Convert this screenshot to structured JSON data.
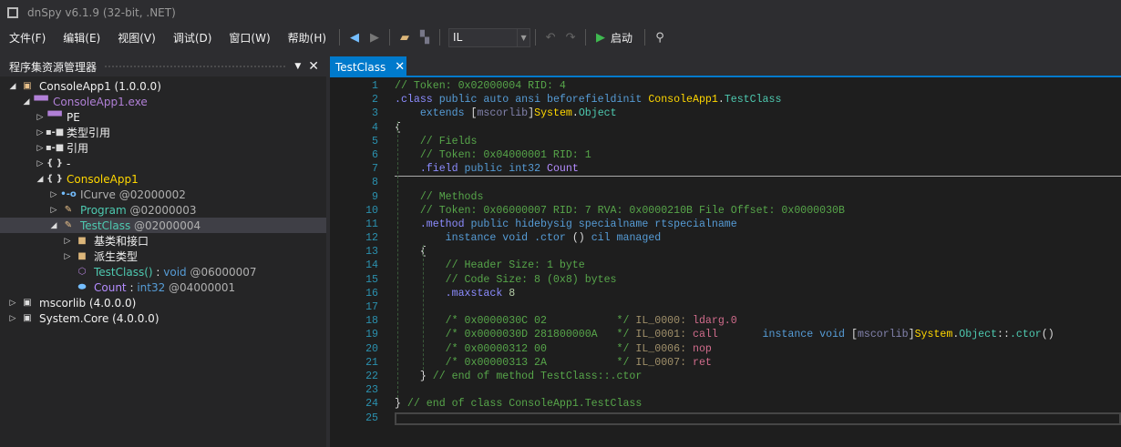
{
  "window": {
    "title": "dnSpy v6.1.9 (32-bit, .NET)"
  },
  "menu": [
    "文件(F)",
    "编辑(E)",
    "视图(V)",
    "调试(D)",
    "窗口(W)",
    "帮助(H)"
  ],
  "toolbar": {
    "language": "IL",
    "start_label": "启动"
  },
  "explorer": {
    "title": "程序集资源管理器",
    "rows": [
      {
        "indent": 0,
        "tw": "◢",
        "icon": "assembly-icon",
        "glyph": "▣",
        "gc": "#e8c08a",
        "parts": [
          [
            "ConsoleApp1 (1.0.0.0)",
            "#f1f1f1"
          ]
        ]
      },
      {
        "indent": 1,
        "tw": "◢",
        "icon": "module-icon",
        "glyph": "▀▀",
        "gc": "#b180d7",
        "parts": [
          [
            "ConsoleApp1.exe",
            "#b180d7"
          ]
        ]
      },
      {
        "indent": 2,
        "tw": "▷",
        "icon": "pe-icon",
        "glyph": "▀▀",
        "gc": "#b180d7",
        "parts": [
          [
            "PE",
            "#f1f1f1"
          ]
        ]
      },
      {
        "indent": 2,
        "tw": "▷",
        "icon": "type-references-icon",
        "glyph": "▪-■",
        "gc": "#ddd",
        "parts": [
          [
            "类型引用",
            "#f1f1f1"
          ]
        ]
      },
      {
        "indent": 2,
        "tw": "▷",
        "icon": "references-icon",
        "glyph": "▪-■",
        "gc": "#ddd",
        "parts": [
          [
            "引用",
            "#f1f1f1"
          ]
        ]
      },
      {
        "indent": 2,
        "tw": "▷",
        "icon": "namespace-icon",
        "glyph": "{ }",
        "gc": "#ddd",
        "parts": [
          [
            "-",
            "#f1f1f1"
          ]
        ]
      },
      {
        "indent": 2,
        "tw": "◢",
        "icon": "namespace-icon",
        "glyph": "{ }",
        "gc": "#ddd",
        "parts": [
          [
            "ConsoleApp1",
            "#ffd700"
          ]
        ]
      },
      {
        "indent": 3,
        "tw": "▷",
        "icon": "interface-icon",
        "glyph": "•-o",
        "gc": "#75beff",
        "parts": [
          [
            "ICurve",
            "#b0b0b0"
          ],
          [
            " @02000002",
            "#b0b0b0"
          ]
        ]
      },
      {
        "indent": 3,
        "tw": "▷",
        "icon": "class-icon",
        "glyph": "✎",
        "gc": "#e8c08a",
        "parts": [
          [
            "Program",
            "#4ec9b0"
          ],
          [
            " @02000003",
            "#b0b0b0"
          ]
        ]
      },
      {
        "indent": 3,
        "tw": "◢",
        "icon": "class-icon",
        "glyph": "✎",
        "gc": "#e8c08a",
        "sel": true,
        "parts": [
          [
            "TestClass",
            "#4ec9b0"
          ],
          [
            " @02000004",
            "#b0b0b0"
          ]
        ]
      },
      {
        "indent": 4,
        "tw": "▷",
        "icon": "folder-icon",
        "glyph": "■",
        "gc": "#dcb67a",
        "parts": [
          [
            "基类和接口",
            "#f1f1f1"
          ]
        ]
      },
      {
        "indent": 4,
        "tw": "▷",
        "icon": "folder-icon",
        "glyph": "■",
        "gc": "#dcb67a",
        "parts": [
          [
            "派生类型",
            "#f1f1f1"
          ]
        ]
      },
      {
        "indent": 4,
        "tw": "",
        "icon": "method-icon",
        "glyph": "⬡",
        "gc": "#b180d7",
        "parts": [
          [
            "TestClass()",
            "#4ec9b0"
          ],
          [
            " : ",
            "#f1f1f1"
          ],
          [
            "void",
            "#569cd6"
          ],
          [
            " @06000007",
            "#b0b0b0"
          ]
        ]
      },
      {
        "indent": 4,
        "tw": "",
        "icon": "field-icon",
        "glyph": "⬬",
        "gc": "#75beff",
        "parts": [
          [
            "Count",
            "#b48cff"
          ],
          [
            " : ",
            "#f1f1f1"
          ],
          [
            "int32",
            "#569cd6"
          ],
          [
            " @04000001",
            "#b0b0b0"
          ]
        ]
      },
      {
        "indent": 0,
        "tw": "▷",
        "icon": "assembly-icon",
        "glyph": "▣",
        "gc": "#ddd",
        "parts": [
          [
            "mscorlib (4.0.0.0)",
            "#f1f1f1"
          ]
        ]
      },
      {
        "indent": 0,
        "tw": "▷",
        "icon": "assembly-icon",
        "glyph": "▣",
        "gc": "#ddd",
        "parts": [
          [
            "System.Core (4.0.0.0)",
            "#f1f1f1"
          ]
        ]
      }
    ]
  },
  "editor": {
    "tab": "TestClass",
    "lines": [
      [
        [
          "// Token: 0x02000004 RID: 4",
          "c"
        ]
      ],
      [
        [
          ".class",
          "d"
        ],
        [
          " public auto ansi beforefieldinit ",
          "k"
        ],
        [
          "ConsoleApp1",
          "y"
        ],
        [
          ".",
          "p"
        ],
        [
          "TestClass",
          "t"
        ]
      ],
      [
        [
          "    extends ",
          "k"
        ],
        [
          "[",
          "p"
        ],
        [
          "mscorlib",
          "m"
        ],
        [
          "]",
          "p"
        ],
        [
          "System",
          "y"
        ],
        [
          ".",
          "p"
        ],
        [
          "Object",
          "t"
        ]
      ],
      [
        [
          "{",
          "p"
        ]
      ],
      [
        [
          "    // Fields",
          "c"
        ]
      ],
      [
        [
          "    // Token: 0x04000001 RID: 1",
          "c"
        ]
      ],
      [
        [
          "    .field",
          "d"
        ],
        [
          " public int32 ",
          "k"
        ],
        [
          "Count",
          "f"
        ]
      ],
      [],
      [
        [
          "    // Methods",
          "c"
        ]
      ],
      [
        [
          "    // Token: 0x06000007 RID: 7 RVA: 0x0000210B File Offset: 0x0000030B",
          "c"
        ]
      ],
      [
        [
          "    .method",
          "d"
        ],
        [
          " public hidebysig specialname rtspecialname",
          "k"
        ]
      ],
      [
        [
          "        instance void ",
          "k"
        ],
        [
          ".ctor",
          "k"
        ],
        [
          " () ",
          "p"
        ],
        [
          "cil managed",
          "k"
        ]
      ],
      [
        [
          "    {",
          "p"
        ]
      ],
      [
        [
          "        // Header Size: 1 byte",
          "c"
        ]
      ],
      [
        [
          "        // Code Size: 8 (0x8) bytes",
          "c"
        ]
      ],
      [
        [
          "        .maxstack",
          "d"
        ],
        [
          " 8",
          "n"
        ]
      ],
      [],
      [
        [
          "        /* 0x0000030C 02           */ ",
          "c"
        ],
        [
          "IL_0000:",
          "l"
        ],
        [
          " ldarg.0",
          "o"
        ]
      ],
      [
        [
          "        /* 0x0000030D 281800000A   */ ",
          "c"
        ],
        [
          "IL_0001:",
          "l"
        ],
        [
          " call",
          "o"
        ],
        [
          "       instance void ",
          "k"
        ],
        [
          "[",
          "p"
        ],
        [
          "mscorlib",
          "m"
        ],
        [
          "]",
          "p"
        ],
        [
          "System",
          "y"
        ],
        [
          ".",
          "p"
        ],
        [
          "Object",
          "t"
        ],
        [
          "::",
          "p"
        ],
        [
          ".ctor",
          "t"
        ],
        [
          "()",
          "p"
        ]
      ],
      [
        [
          "        /* 0x00000312 00           */ ",
          "c"
        ],
        [
          "IL_0006:",
          "l"
        ],
        [
          " nop",
          "o"
        ]
      ],
      [
        [
          "        /* 0x00000313 2A           */ ",
          "c"
        ],
        [
          "IL_0007:",
          "l"
        ],
        [
          " ret",
          "o"
        ]
      ],
      [
        [
          "    } ",
          "p"
        ],
        [
          "// end of method TestClass::.ctor",
          "c"
        ]
      ],
      [],
      [
        [
          "} ",
          "p"
        ],
        [
          "// end of class ConsoleApp1.TestClass",
          "c"
        ]
      ],
      []
    ]
  }
}
